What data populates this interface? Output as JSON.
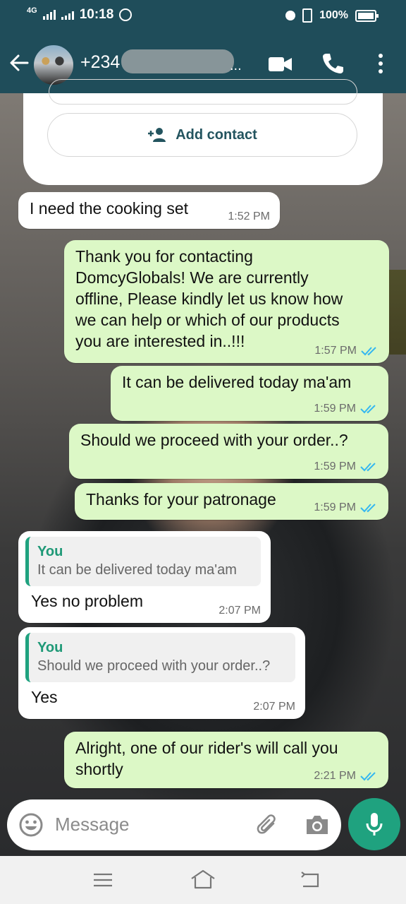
{
  "status_bar": {
    "network": "4G",
    "time": "10:18",
    "battery": "100%"
  },
  "header": {
    "contact_name": "+234",
    "contact_suffix": "..."
  },
  "card": {
    "add_contact_label": "Add contact"
  },
  "messages": [
    {
      "direction": "in",
      "text": "I need the cooking set",
      "time": "1:52 PM"
    },
    {
      "direction": "out",
      "lines": [
        "Thank you for contacting",
        "DomcyGlobals! We are currently",
        "offline, Please kindly let us know how",
        "we can help or which of our products",
        "you are interested in..!!!"
      ],
      "time": "1:57 PM"
    },
    {
      "direction": "out",
      "text": "It can be delivered today ma'am",
      "time": "1:59 PM"
    },
    {
      "direction": "out",
      "text": "Should we proceed with your order..?",
      "time": "1:59 PM"
    },
    {
      "direction": "out",
      "text": "Thanks for your patronage",
      "time": "1:59 PM"
    },
    {
      "direction": "in",
      "quote_author": "You",
      "quote_text": "It can be delivered today ma'am",
      "text": "Yes no problem",
      "time": "2:07 PM"
    },
    {
      "direction": "in",
      "quote_author": "You",
      "quote_text": "Should we proceed with your order..?",
      "text": "Yes",
      "time": "2:07 PM"
    },
    {
      "direction": "out",
      "lines": [
        "Alright, one of our rider's will call you",
        "shortly"
      ],
      "time": "2:21 PM"
    }
  ],
  "composer": {
    "placeholder": "Message"
  },
  "colors": {
    "header": "#1f4d5a",
    "outgoing_bubble": "#dcf8c6",
    "incoming_bubble": "#ffffff",
    "accent": "#1fa27f",
    "read_ticks": "#34b7f1"
  },
  "icons": {
    "back": "arrow-left-icon",
    "video": "video-camera-icon",
    "call": "phone-icon",
    "menu": "more-vertical-icon",
    "add_contact": "person-add-icon",
    "emoji": "emoji-icon",
    "attach": "paperclip-icon",
    "camera": "camera-icon",
    "mic": "microphone-icon"
  }
}
